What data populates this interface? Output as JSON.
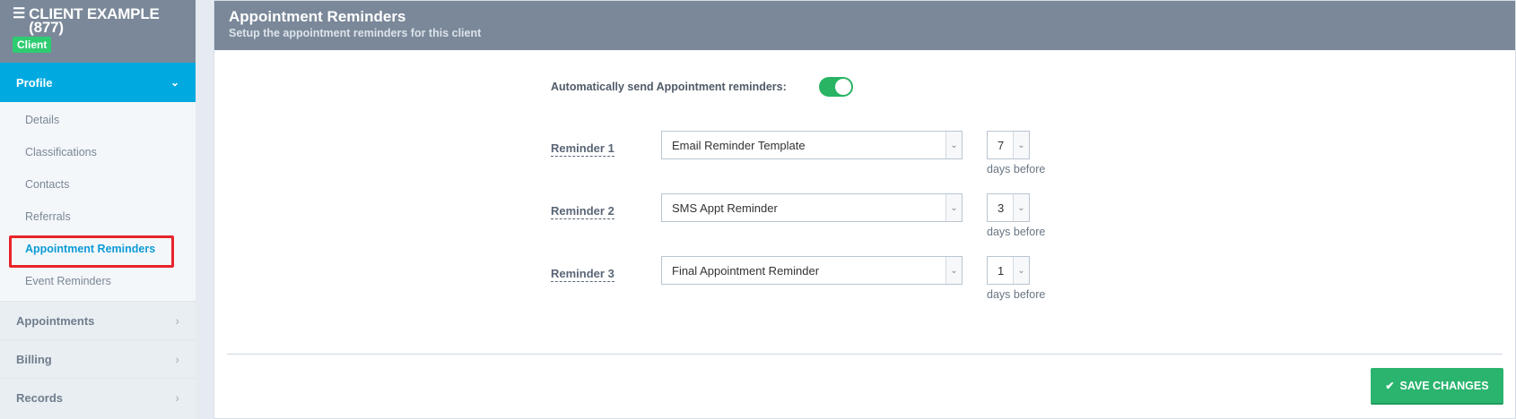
{
  "client": {
    "name": "CLIENT EXAMPLE",
    "id": "(877)",
    "badge": "Client"
  },
  "sidebar": {
    "profile_label": "Profile",
    "profile_items": [
      {
        "label": "Details"
      },
      {
        "label": "Classifications"
      },
      {
        "label": "Contacts"
      },
      {
        "label": "Referrals"
      },
      {
        "label": "Appointment Reminders",
        "active": true
      },
      {
        "label": "Event Reminders"
      }
    ],
    "sections": [
      {
        "label": "Appointments"
      },
      {
        "label": "Billing"
      },
      {
        "label": "Records"
      }
    ]
  },
  "panel": {
    "title": "Appointment Reminders",
    "subtitle": "Setup the appointment reminders for this client"
  },
  "form": {
    "auto_label": "Automatically send Appointment reminders:",
    "auto_enabled": true,
    "reminders": [
      {
        "label": "Reminder 1",
        "template": "Email Reminder Template",
        "days": "7",
        "days_label": "days before"
      },
      {
        "label": "Reminder 2",
        "template": "SMS Appt Reminder",
        "days": "3",
        "days_label": "days before"
      },
      {
        "label": "Reminder 3",
        "template": "Final Appointment Reminder",
        "days": "1",
        "days_label": "days before"
      }
    ],
    "save_label": "SAVE CHANGES"
  },
  "colors": {
    "header": "#7a8899",
    "active_nav": "#00a9e0",
    "badge": "#2ecc71",
    "toggle_on": "#28b463",
    "save_button": "#2ab46e",
    "highlight": "#e8232a"
  }
}
